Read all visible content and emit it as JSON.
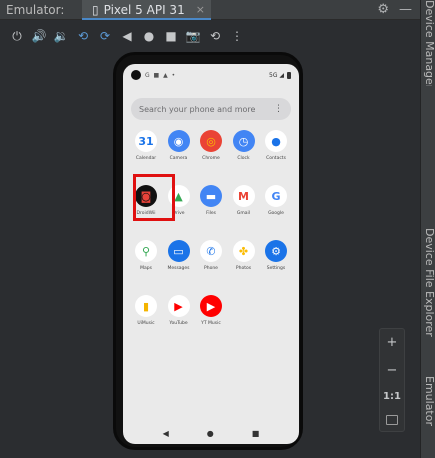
{
  "titlebar": {
    "panel_label": "Emulator:",
    "device_tab": "Pixel 5 API 31",
    "tab_close": "×",
    "settings_icon": "⚙",
    "minimize_icon": "—"
  },
  "toolbar": {
    "buttons": [
      {
        "name": "power",
        "glyph": "⏻"
      },
      {
        "name": "volume-up",
        "glyph": "🔊"
      },
      {
        "name": "volume-down",
        "glyph": "🔉"
      },
      {
        "name": "rotate-left",
        "glyph": "⟲"
      },
      {
        "name": "rotate-right",
        "glyph": "⟳"
      },
      {
        "name": "back",
        "glyph": "◀"
      },
      {
        "name": "home",
        "glyph": "●"
      },
      {
        "name": "overview",
        "glyph": "■"
      },
      {
        "name": "screenshot",
        "glyph": "📷"
      },
      {
        "name": "snapshot",
        "glyph": "⟲"
      },
      {
        "name": "more",
        "glyph": "⋮"
      }
    ]
  },
  "side_panel": {
    "top": "Device Manager",
    "middle": "Device File Explorer",
    "bottom": "Emulator"
  },
  "zoom": {
    "plus": "+",
    "minus": "−",
    "one_to_one": "1:1"
  },
  "phone": {
    "status_left_dots": "G ■ ▲ •",
    "status_right": "5G ◢",
    "search_placeholder": "Search your phone and more",
    "search_more": "⋮",
    "nav": {
      "back": "◀",
      "home": "●",
      "recents": "■"
    },
    "apps": [
      [
        {
          "label": "Calendar",
          "glyph": "31",
          "bg": "#ffffff",
          "fg": "#1a73e8"
        },
        {
          "label": "Camera",
          "glyph": "◉",
          "bg": "#4285f4",
          "fg": "#ffffff"
        },
        {
          "label": "Chrome",
          "glyph": "◎",
          "bg": "#ea4335",
          "fg": "#fbbc04"
        },
        {
          "label": "Clock",
          "glyph": "◷",
          "bg": "#4285f4",
          "fg": "#ffffff"
        },
        {
          "label": "Contacts",
          "glyph": "●",
          "bg": "#ffffff",
          "fg": "#1a73e8"
        }
      ],
      [
        {
          "label": "DroidWii",
          "glyph": "◙",
          "bg": "#111111",
          "fg": "#e8433a"
        },
        {
          "label": "Drive",
          "glyph": "▲",
          "bg": "#ffffff",
          "fg": "#34a853"
        },
        {
          "label": "Files",
          "glyph": "▬",
          "bg": "#4285f4",
          "fg": "#ffffff"
        },
        {
          "label": "Gmail",
          "glyph": "M",
          "bg": "#ffffff",
          "fg": "#ea4335"
        },
        {
          "label": "Google",
          "glyph": "G",
          "bg": "#ffffff",
          "fg": "#4285f4"
        }
      ],
      [
        {
          "label": "Maps",
          "glyph": "⚲",
          "bg": "#ffffff",
          "fg": "#34a853"
        },
        {
          "label": "Messages",
          "glyph": "▭",
          "bg": "#1a73e8",
          "fg": "#ffffff"
        },
        {
          "label": "Phone",
          "glyph": "✆",
          "bg": "#ffffff",
          "fg": "#1a73e8"
        },
        {
          "label": "Photos",
          "glyph": "✤",
          "bg": "#ffffff",
          "fg": "#fbbc04"
        },
        {
          "label": "Settings",
          "glyph": "⚙",
          "bg": "#1a73e8",
          "fg": "#ffffff"
        }
      ],
      [
        {
          "label": "UiMusic",
          "glyph": "▮",
          "bg": "#ffffff",
          "fg": "#f4b400"
        },
        {
          "label": "YouTube",
          "glyph": "▶",
          "bg": "#ffffff",
          "fg": "#ff0000"
        },
        {
          "label": "YT Music",
          "glyph": "▶",
          "bg": "#ff0000",
          "fg": "#ffffff"
        }
      ]
    ]
  }
}
